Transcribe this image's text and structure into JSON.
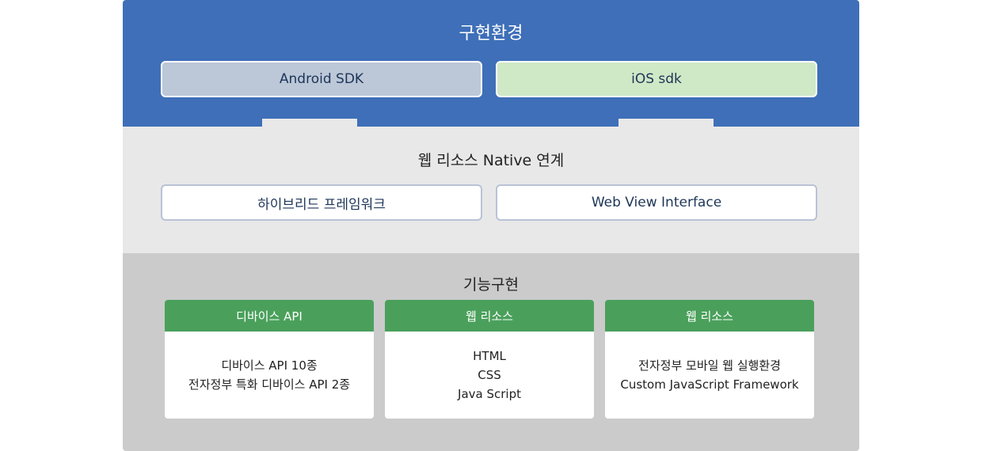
{
  "top": {
    "title": "구현환경",
    "android": "Android SDK",
    "ios": "iOS sdk"
  },
  "middle": {
    "title": "웹 리소스 Native 연계",
    "left": "하이브리드 프레임워크",
    "right": "Web View Interface"
  },
  "bottom": {
    "title": "기능구현",
    "cards": [
      {
        "header": "디바이스 API",
        "lines": [
          "디바이스 API 10종",
          "전자정부 특화 디바이스 API 2종"
        ]
      },
      {
        "header": "웹 리소스",
        "lines": [
          "HTML",
          "CSS",
          "Java Script"
        ]
      },
      {
        "header": "웹 리소스",
        "lines": [
          "전자정부 모바일 웹 실행환경",
          "Custom JavaScript Framework"
        ]
      }
    ]
  },
  "colors": {
    "top_band": "#3e6fb8",
    "middle_band": "#e8e8e8",
    "bottom_band": "#cbcbcb",
    "android_box": "#bcc7d8",
    "ios_box": "#cfe8c6",
    "card_header": "#4aa05b"
  }
}
